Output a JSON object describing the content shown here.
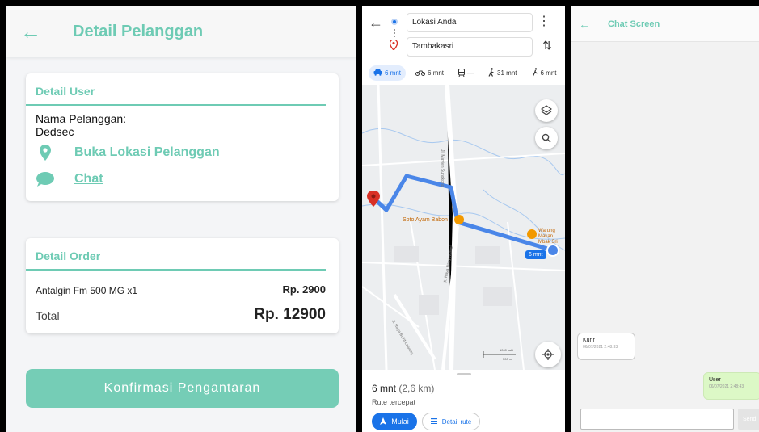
{
  "panel1": {
    "title": "Detail Pelanggan",
    "user_card": {
      "header": "Detail User",
      "name_label": "Nama Pelanggan:",
      "name_value": "Dedsec",
      "location_link": "Buka Lokasi Pelanggan",
      "chat_link": "Chat"
    },
    "order_card": {
      "header": "Detail Order",
      "item": "Antalgin Fm 500 MG x1",
      "item_price": "Rp. 2900",
      "total_label": "Total",
      "total_value": "Rp. 12900"
    },
    "confirm_button": "Konfirmasi Pengantaran",
    "accent": "#6ecbb4"
  },
  "panel2": {
    "origin": "Lokasi Anda",
    "destination": "Tambakasri",
    "modes": [
      {
        "icon": "car-icon",
        "label": "6 mnt",
        "active": true
      },
      {
        "icon": "motorbike-icon",
        "label": "6 mnt",
        "active": false
      },
      {
        "icon": "transit-icon",
        "label": "—",
        "active": false
      },
      {
        "icon": "walk-icon",
        "label": "31 mnt",
        "active": false
      },
      {
        "icon": "bike-icon",
        "label": "6 mnt",
        "active": false
      }
    ],
    "map_labels": {
      "road1": "Jl. Mayjen Sungkono",
      "road2": "Jl. Raya Banyuwangi",
      "road3": "Jl. Raya Bukit Lawang",
      "poi1": "Soto Ayam Babon",
      "poi2": "Warung Makan Mbak Sri",
      "scale1": "1000 kaki",
      "scale2": "500 m",
      "route_badge": "6 mnt"
    },
    "eta": "6 mnt",
    "distance": "(2,6 km)",
    "route_label": "Rute tercepat",
    "start_button": "Mulai",
    "detail_button": "Detail rute",
    "route_color": "#4a86e8"
  },
  "panel3": {
    "title": "Chat Screen",
    "messages": [
      {
        "sender": "Kurir",
        "time": "06/07/2021 2:48:33"
      },
      {
        "sender": "User",
        "time": "06/07/2021 2:48:43"
      }
    ],
    "send_label": "Send"
  }
}
